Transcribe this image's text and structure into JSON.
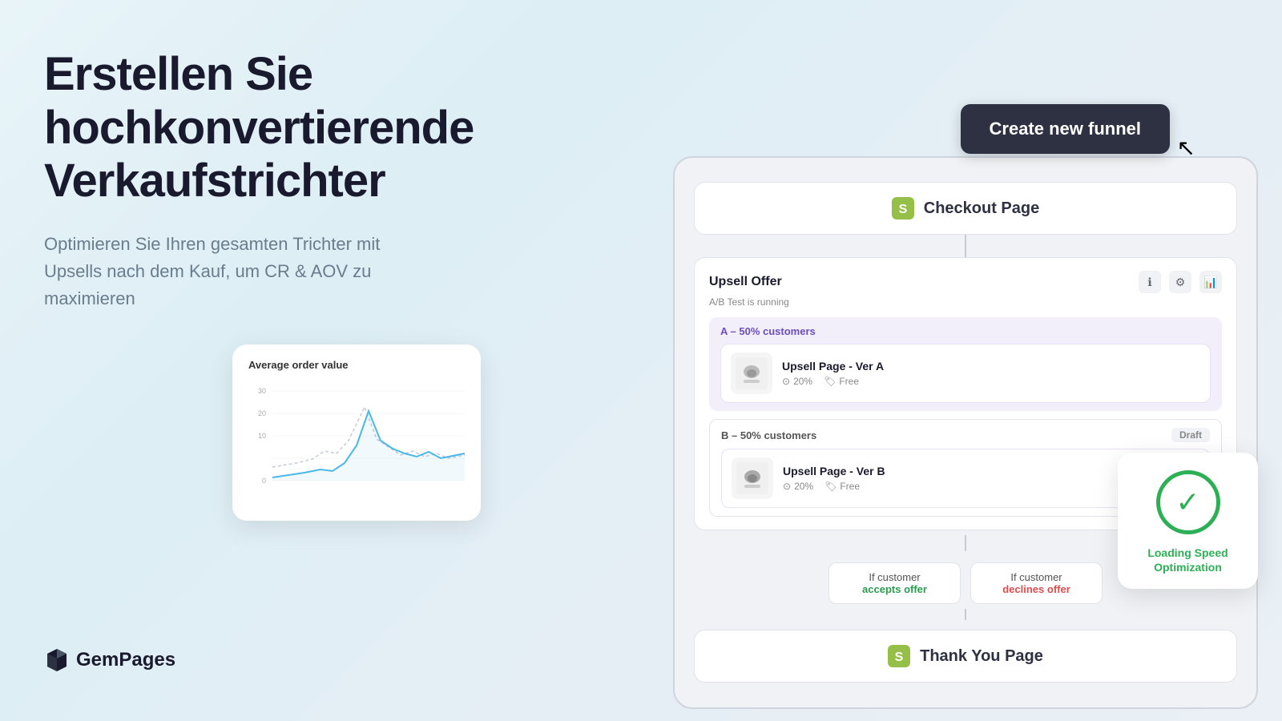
{
  "hero": {
    "title": "Erstellen Sie hochkonvertierende Verkaufstrichter",
    "subtitle": "Optimieren Sie Ihren gesamten Trichter mit Upsells nach dem Kauf, um CR & AOV zu maximieren"
  },
  "logo": {
    "name": "GemPages"
  },
  "cta": {
    "label": "Create new funnel"
  },
  "chart": {
    "title": "Average order value",
    "y_labels": [
      "30",
      "20",
      "10",
      "0"
    ]
  },
  "funnel": {
    "checkout_page": "Checkout Page",
    "upsell_offer_title": "Upsell Offer",
    "upsell_offer_subtitle": "A/B Test is running",
    "ab_a_label": "A – 50% customers",
    "ab_b_label": "B – 50% customers",
    "variant_a_name": "Upsell Page - Ver A",
    "variant_b_name": "Upsell Page - Ver B",
    "variant_a_discount": "20%",
    "variant_a_price": "Free",
    "variant_b_discount": "20%",
    "variant_b_price": "Free",
    "draft_badge": "Draft",
    "branch_accept": "If customer\naccepts offer",
    "branch_accept_label": "If customer",
    "branch_accept_label2": "accepts offer",
    "branch_decline_label": "If customer",
    "branch_decline_label2": "declines offer",
    "thank_you_page": "Thank You Page"
  },
  "speed_card": {
    "text": "Loading Speed\nOptimization",
    "line1": "Loading Speed",
    "line2": "Optimization"
  }
}
